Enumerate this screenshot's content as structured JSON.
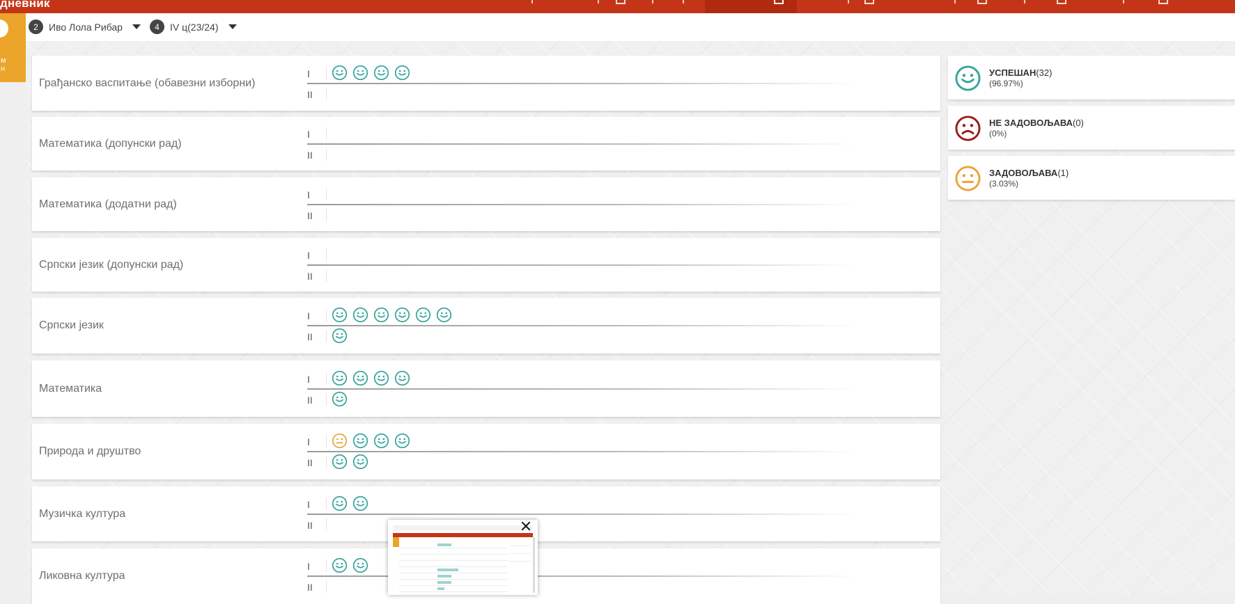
{
  "app": {
    "title": "дневник"
  },
  "side_badge": {
    "text_line1": "м",
    "text_line2": "н"
  },
  "selectors": {
    "school": {
      "number": "2",
      "label": "Иво Лола Рибар"
    },
    "class": {
      "number": "4",
      "label": "IV ц(23/24)"
    }
  },
  "semester_labels": {
    "first": "I",
    "second": "II"
  },
  "colors": {
    "topbar": "#c43518",
    "accent_orange": "#eba42a",
    "success": "#35a49c",
    "fail": "#9b1b1b",
    "sufficient": "#e9a43a"
  },
  "subjects": [
    {
      "name": "Грађанско васпитање (обавезни изборни)",
      "first": [
        "success",
        "success",
        "success",
        "success"
      ],
      "second": []
    },
    {
      "name": "Математика (допунски рад)",
      "first": [],
      "second": []
    },
    {
      "name": "Математика (додатни рад)",
      "first": [],
      "second": []
    },
    {
      "name": "Српски језик (допунски рад)",
      "first": [],
      "second": []
    },
    {
      "name": "Српски језик",
      "first": [
        "success",
        "success",
        "success",
        "success",
        "success",
        "success"
      ],
      "second": [
        "success"
      ]
    },
    {
      "name": "Математика",
      "first": [
        "success",
        "success",
        "success",
        "success"
      ],
      "second": [
        "success"
      ]
    },
    {
      "name": "Природа и друштво",
      "first": [
        "sufficient",
        "success",
        "success",
        "success"
      ],
      "second": [
        "success",
        "success"
      ]
    },
    {
      "name": "Музичка култура",
      "first": [
        "success",
        "success"
      ],
      "second": []
    },
    {
      "name": "Ликовна култура",
      "first": [
        "success",
        "success"
      ],
      "second": []
    }
  ],
  "summary": [
    {
      "type": "success",
      "label": "УСПЕШАН",
      "count": "(32)",
      "percent": "(96.97%)"
    },
    {
      "type": "fail",
      "label": "НЕ ЗАДОВОЉАВА",
      "count": "(0)",
      "percent": "(0%)"
    },
    {
      "type": "sufficient",
      "label": "ЗАДОВОЉАВА",
      "count": "(1)",
      "percent": "(3.03%)"
    }
  ]
}
